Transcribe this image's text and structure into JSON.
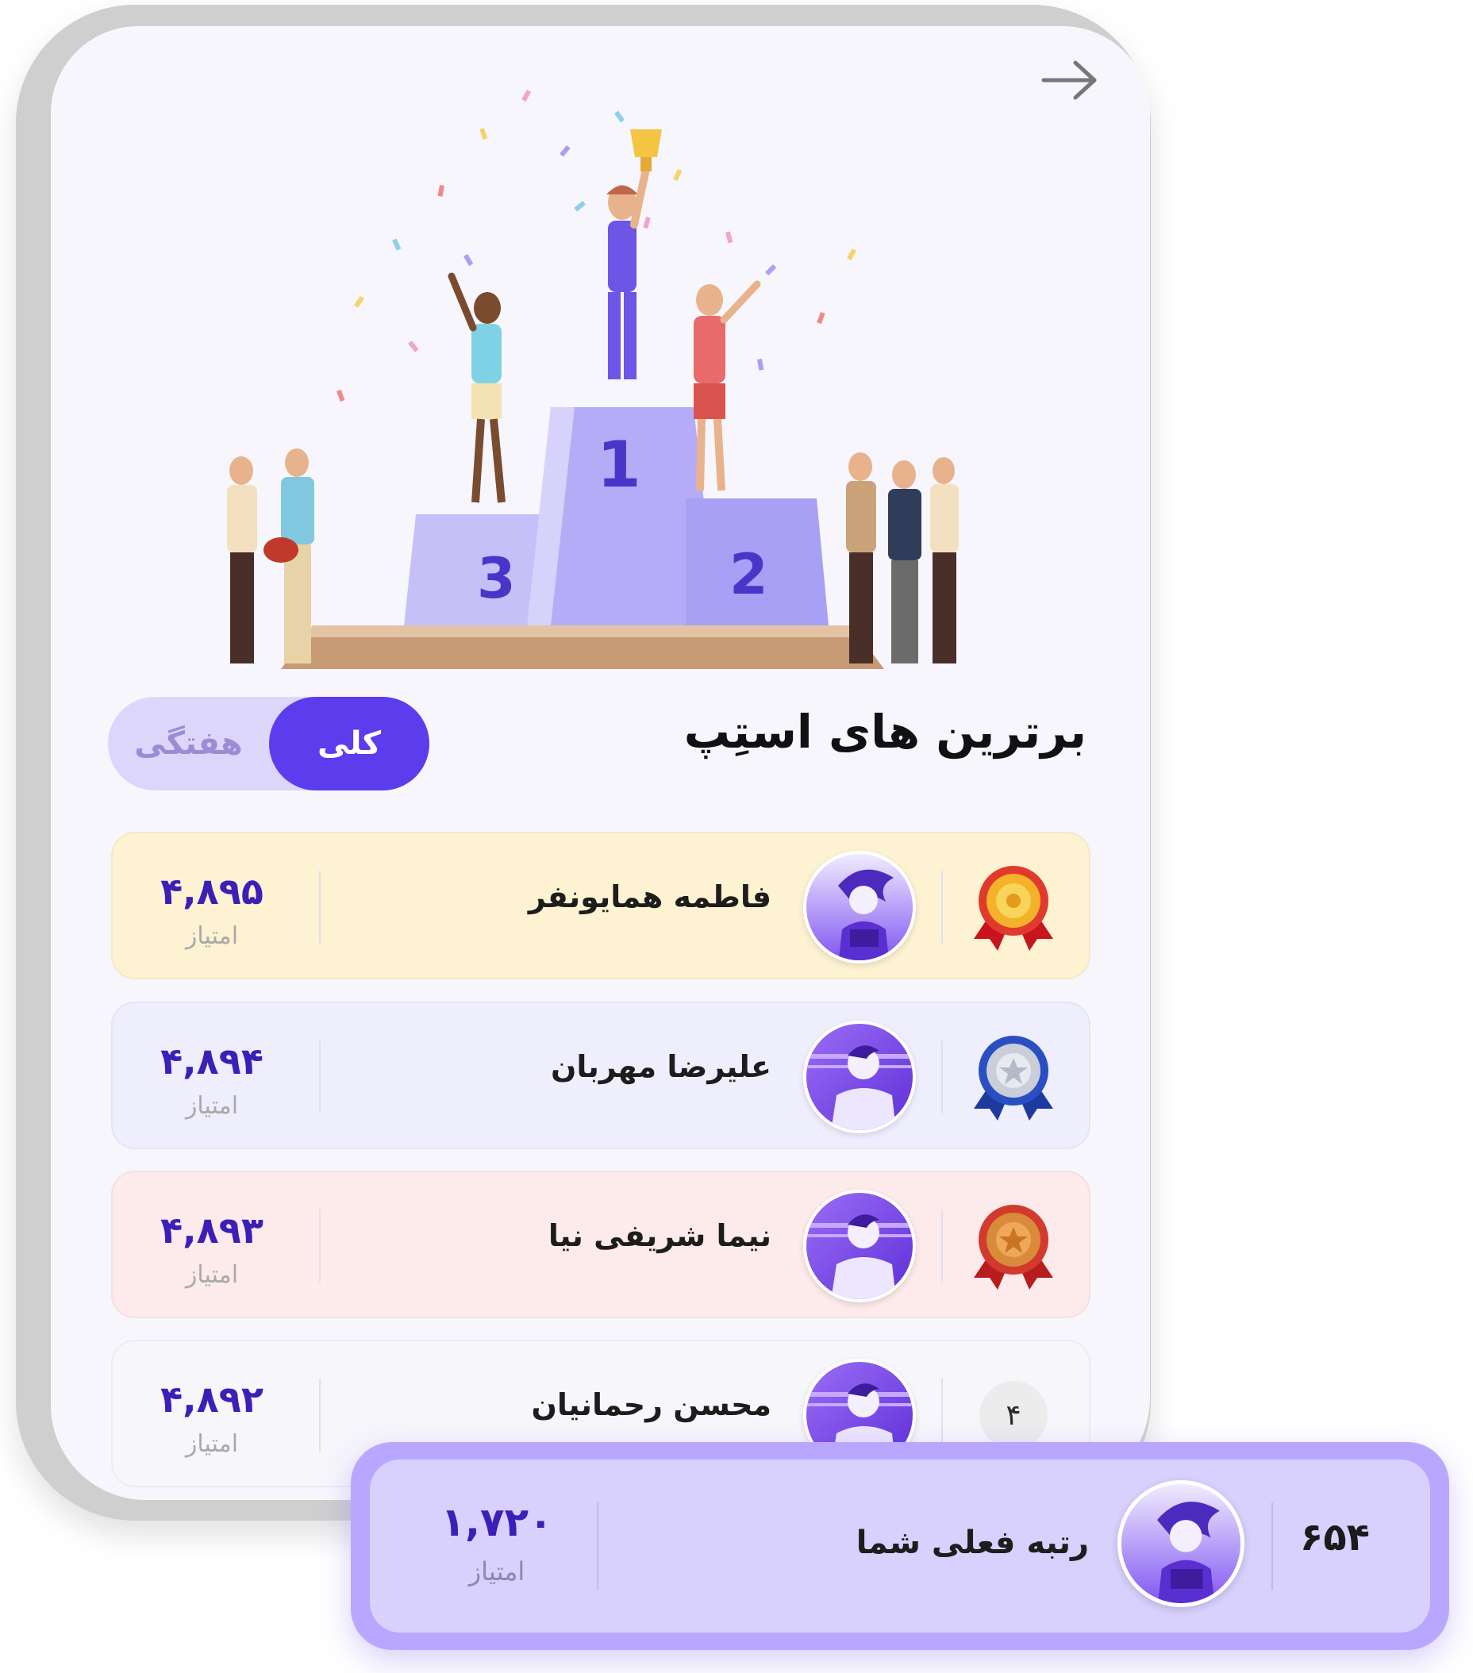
{
  "header": {
    "back_icon": "arrow-right-icon",
    "title": "برترین های استِپ"
  },
  "tabs": {
    "active": "کلی",
    "inactive": "هفتگی"
  },
  "score_label": "امتیاز",
  "leaderboard": [
    {
      "rank": "1",
      "medal": "gold-medal-icon",
      "name": "فاطمه همایونفر",
      "score": "۴,۸۹۵",
      "bg": "#fdf2d2",
      "avatar": "female-runner"
    },
    {
      "rank": "2",
      "medal": "silver-medal-icon",
      "name": "علیرضا مهربان",
      "score": "۴,۸۹۴",
      "bg": "#efeefc",
      "avatar": "male-runner"
    },
    {
      "rank": "3",
      "medal": "bronze-medal-icon",
      "name": "نیما شریفی نیا",
      "score": "۴,۸۹۳",
      "bg": "#fdeaea",
      "avatar": "male-runner"
    },
    {
      "rank": "۴",
      "medal": null,
      "name": "محسن رحمانیان",
      "score": "۴,۸۹۲",
      "bg": "#f7f6fb",
      "avatar": "male-runner"
    }
  ],
  "current_user": {
    "rank": "۶۵۴",
    "label": "رتبه فعلی شما",
    "score": "۱,۷۲۰",
    "avatar": "female-runner"
  },
  "colors": {
    "accent": "#5d3cee",
    "score": "#3b1fb7",
    "podium": "#a8a0f4"
  }
}
